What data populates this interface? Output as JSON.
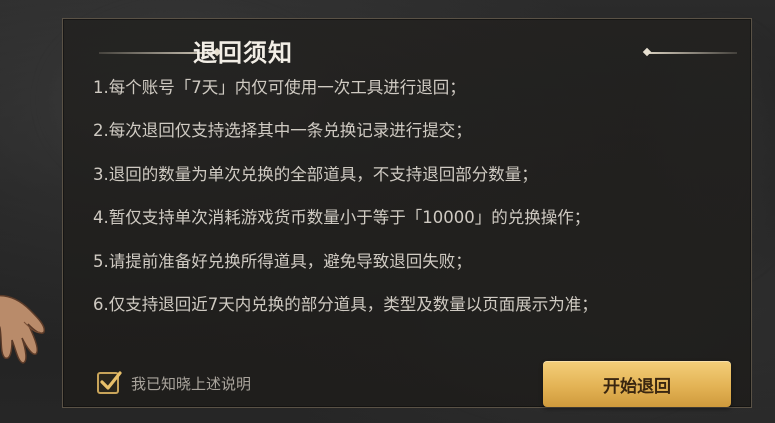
{
  "dialog": {
    "title": "退回须知",
    "rules": [
      "1.每个账号「7天」内仅可使用一次工具进行退回；",
      "2.每次退回仅支持选择其中一条兑换记录进行提交；",
      "3.退回的数量为单次兑换的全部道具，不支持退回部分数量；",
      "4.暂仅支持单次消耗游戏货币数量小于等于「10000」的兑换操作；",
      "5.请提前准备好兑换所得道具，避免导致退回失败；",
      "6.仅支持退回近7天内兑换的部分道具，类型及数量以页面展示为准；"
    ],
    "acknowledge": {
      "checked": true,
      "label": "我已知晓上述说明"
    },
    "start_button": "开始退回"
  },
  "colors": {
    "accent": "#e3b355",
    "checkbox_border": "#c8a45a",
    "text": "#cfcac2",
    "title": "#f2eee6"
  }
}
